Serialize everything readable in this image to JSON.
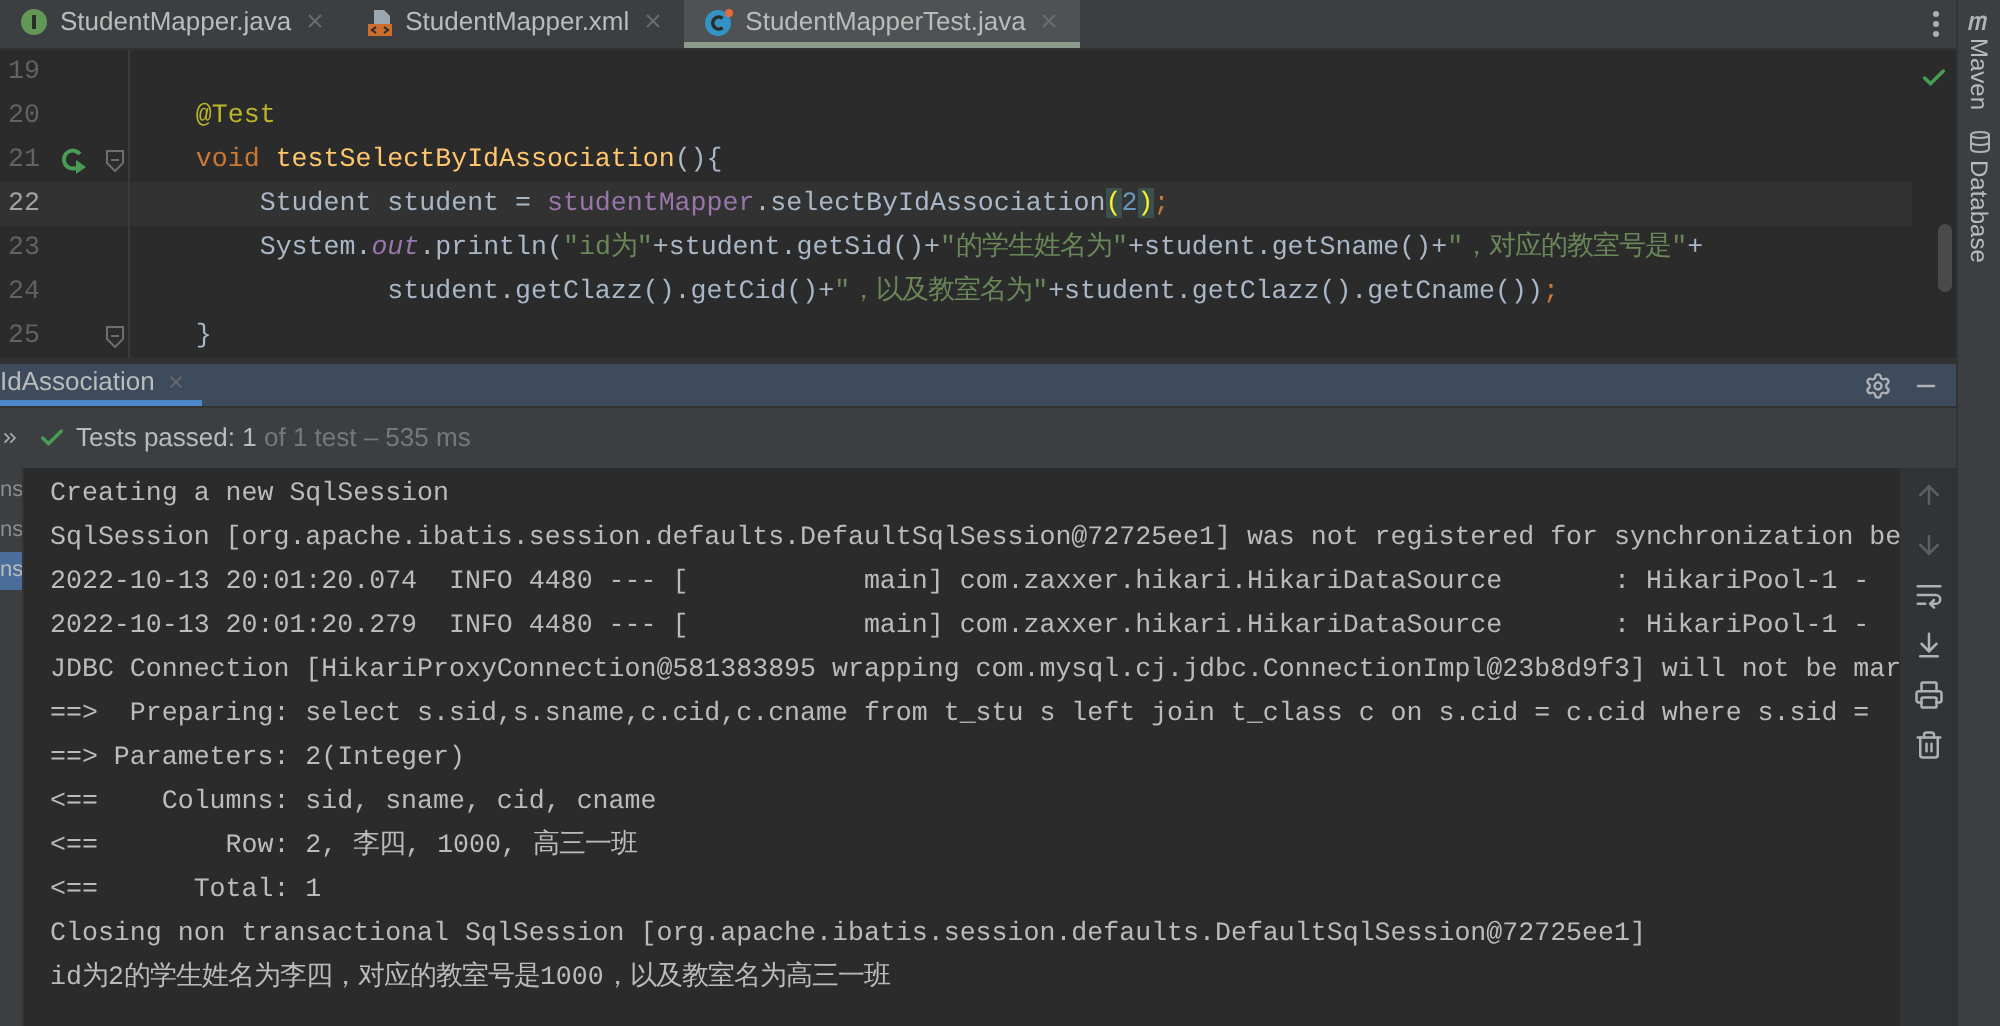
{
  "editor_tabs": [
    {
      "label": "StudentMapper.java",
      "kind": "interface",
      "selected": false
    },
    {
      "label": "StudentMapper.xml",
      "kind": "xml",
      "selected": false
    },
    {
      "label": "StudentMapperTest.java",
      "kind": "test",
      "selected": true
    }
  ],
  "editor": {
    "lines": [
      {
        "number": "19",
        "current": false,
        "run_icon": false,
        "fold": false
      },
      {
        "number": "20",
        "current": false,
        "run_icon": false,
        "fold": false,
        "tokens": [
          {
            "kind": "annotation",
            "text": "    @Test"
          }
        ]
      },
      {
        "number": "21",
        "current": false,
        "run_icon": true,
        "fold": true,
        "tokens": [
          {
            "kind": "keyword",
            "text": "    void "
          },
          {
            "kind": "decl",
            "text": "testSelectByIdAssociation"
          },
          {
            "kind": "plain",
            "text": "(){"
          }
        ]
      },
      {
        "number": "22",
        "current": true,
        "run_icon": false,
        "fold": false,
        "tokens": [
          {
            "kind": "plain",
            "text": "        Student student = "
          },
          {
            "kind": "field",
            "text": "studentMapper"
          },
          {
            "kind": "plain",
            "text": ".selectByIdAssociation"
          },
          {
            "kind": "match",
            "text": "("
          },
          {
            "kind": "number",
            "text": "2"
          },
          {
            "kind": "match",
            "text": ")"
          },
          {
            "kind": "punct",
            "text": ";"
          }
        ]
      },
      {
        "number": "23",
        "current": false,
        "run_icon": false,
        "fold": false,
        "tokens": [
          {
            "kind": "plain",
            "text": "        System."
          },
          {
            "kind": "static",
            "text": "out"
          },
          {
            "kind": "plain",
            "text": ".println("
          },
          {
            "kind": "string",
            "text": "\"id为\""
          },
          {
            "kind": "plain",
            "text": "+student.getSid()+"
          },
          {
            "kind": "string",
            "text": "\"的学生姓名为\""
          },
          {
            "kind": "plain",
            "text": "+student.getSname()+"
          },
          {
            "kind": "string",
            "text": "\"，对应的教室号是\""
          },
          {
            "kind": "plain",
            "text": "+"
          }
        ]
      },
      {
        "number": "24",
        "current": false,
        "run_icon": false,
        "fold": false,
        "tokens": [
          {
            "kind": "plain",
            "text": "                student.getClazz().getCid()+"
          },
          {
            "kind": "string",
            "text": "\"，以及教室名为\""
          },
          {
            "kind": "plain",
            "text": "+student.getClazz().getCname())"
          },
          {
            "kind": "punct",
            "text": ";"
          }
        ]
      },
      {
        "number": "25",
        "current": false,
        "run_icon": false,
        "fold": true,
        "tokens": [
          {
            "kind": "plain",
            "text": "    }"
          }
        ]
      }
    ]
  },
  "side_tools": [
    {
      "label": "Maven",
      "kind": "maven"
    },
    {
      "label": "Database",
      "kind": "database"
    }
  ],
  "run_panel": {
    "tab": {
      "label": "IdAssociation",
      "selected": true
    },
    "status": {
      "label": "Tests passed:",
      "count": "1",
      "detail": "of 1 test – 535 ms"
    },
    "tree_items": [
      {
        "text": "ns",
        "selected": false
      },
      {
        "text": "ns",
        "selected": false
      },
      {
        "text": "ns",
        "selected": true
      }
    ],
    "console": [
      "Creating a new SqlSession",
      "SqlSession [org.apache.ibatis.session.defaults.DefaultSqlSession@72725ee1] was not registered for synchronization be",
      "2022-10-13 20:01:20.074  INFO 4480 --- [           main] com.zaxxer.hikari.HikariDataSource       : HikariPool-1 -",
      "2022-10-13 20:01:20.279  INFO 4480 --- [           main] com.zaxxer.hikari.HikariDataSource       : HikariPool-1 -",
      "JDBC Connection [HikariProxyConnection@581383895 wrapping com.mysql.cj.jdbc.ConnectionImpl@23b8d9f3] will not be mar",
      "==>  Preparing: select s.sid,s.sname,c.cid,c.cname from t_stu s left join t_class c on s.cid = c.cid where s.sid =",
      "==> Parameters: 2(Integer)",
      "<==    Columns: sid, sname, cid, cname",
      "<==        Row: 2, 李四, 1000, 高三一班",
      "<==      Total: 1",
      "Closing non transactional SqlSession [org.apache.ibatis.session.defaults.DefaultSqlSession@72725ee1]",
      "id为2的学生姓名为李四，对应的教室号是1000，以及教室名为高三一班"
    ]
  }
}
